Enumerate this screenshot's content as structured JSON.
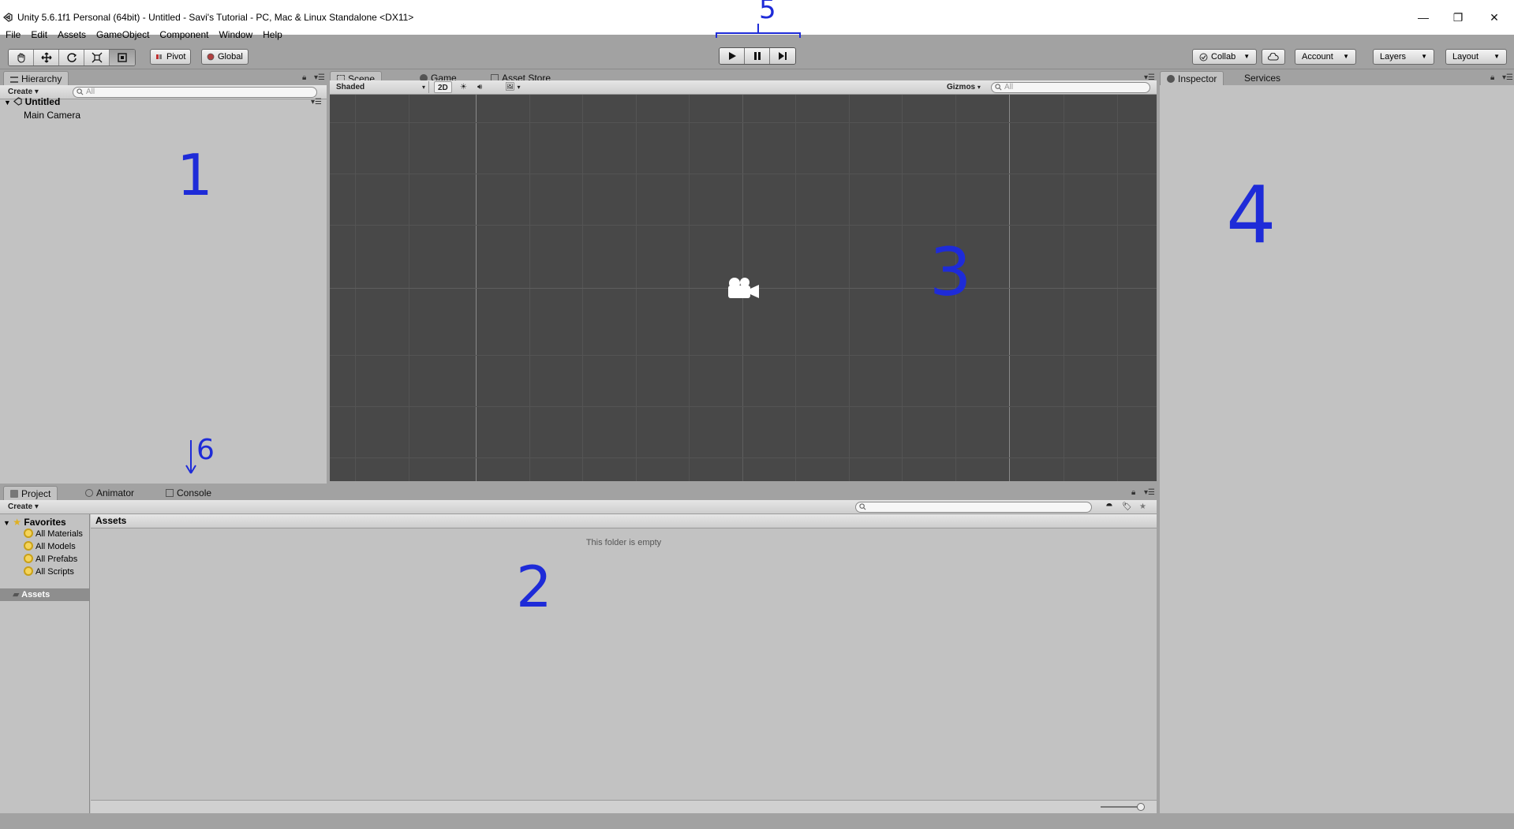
{
  "window": {
    "title": "Unity 5.6.1f1 Personal (64bit) - Untitled - Savi's Tutorial - PC, Mac & Linux Standalone <DX11>",
    "controls": {
      "minimize": "—",
      "restore": "❐",
      "close": "✕"
    }
  },
  "menu": [
    "File",
    "Edit",
    "Assets",
    "GameObject",
    "Component",
    "Window",
    "Help"
  ],
  "toolbar": {
    "tools": [
      "hand-tool",
      "move-tool",
      "rotate-tool",
      "scale-tool",
      "rect-tool"
    ],
    "pivot_label": "Pivot",
    "global_label": "Global",
    "collab_label": "Collab",
    "account_label": "Account",
    "layers_label": "Layers",
    "layout_label": "Layout"
  },
  "hierarchy": {
    "tab_label": "Hierarchy",
    "create_label": "Create",
    "search_placeholder": "All",
    "scene_name": "Untitled",
    "objects": [
      "Main Camera"
    ]
  },
  "scene_view": {
    "tabs": [
      "Scene",
      "Game",
      "Asset Store"
    ],
    "shading_label": "Shaded",
    "mode_2d": "2D",
    "gizmos_label": "Gizmos",
    "search_placeholder": "All"
  },
  "inspector": {
    "tabs": [
      "Inspector",
      "Services"
    ]
  },
  "project": {
    "tabs": [
      "Project",
      "Animator",
      "Console"
    ],
    "create_label": "Create",
    "favorites_label": "Favorites",
    "favorites": [
      "All Materials",
      "All Models",
      "All Prefabs",
      "All Scripts"
    ],
    "assets_folder": "Assets",
    "breadcrumb": "Assets",
    "empty_message": "This folder is empty"
  },
  "annotations": [
    "1",
    "2",
    "3",
    "4",
    "5",
    "6"
  ],
  "colors": {
    "annotation_blue": "#1e2bd8",
    "panel_bg": "#c2c2c2",
    "scene_bg": "#484848",
    "chrome_bg": "#a2a2a2"
  }
}
